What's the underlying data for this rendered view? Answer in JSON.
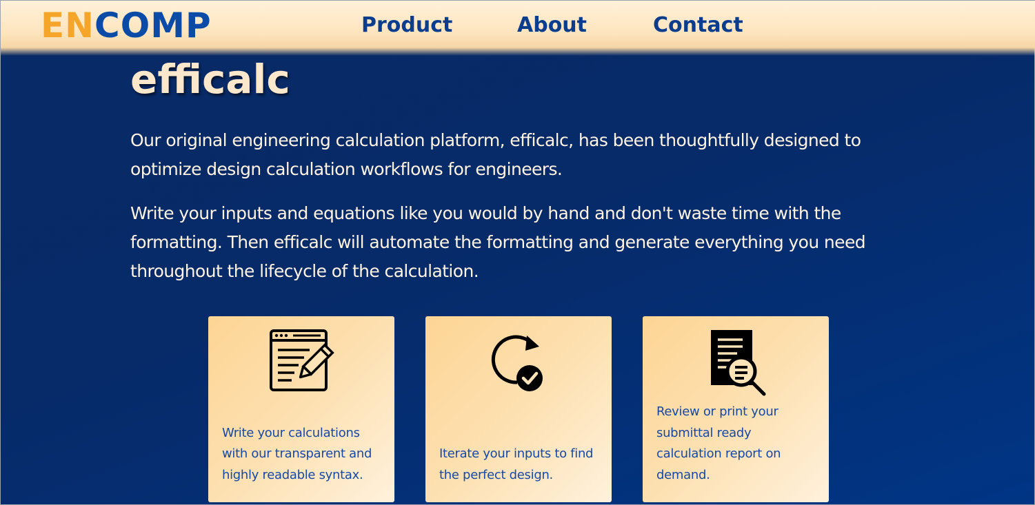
{
  "header": {
    "logo_part1": "EN",
    "logo_part2": "COMP",
    "nav": {
      "product": "Product",
      "about": "About",
      "contact": "Contact"
    }
  },
  "hero": {
    "title": "efficalc",
    "paragraph1": "Our original engineering calculation platform, efficalc, has been thoughtfully designed to optimize design calculation workflows for engineers.",
    "paragraph2": "Write your inputs and equations like you would by hand and don't waste time with the formatting. Then efficalc will automate the formatting and generate everything you need throughout the lifecycle of the calculation."
  },
  "features": [
    {
      "icon": "code-editor-pencil-icon",
      "text": "Write your calculations with our transparent and highly readable syntax."
    },
    {
      "icon": "iterate-check-icon",
      "text": "Iterate your inputs to find the perfect design."
    },
    {
      "icon": "report-review-icon",
      "text": "Review or print your submittal ready calculation report on demand."
    }
  ],
  "colors": {
    "brand_orange": "#f4a52a",
    "brand_blue": "#0b4ba8",
    "background_navy": "#072a68",
    "card_peach": "#fde0b0"
  }
}
